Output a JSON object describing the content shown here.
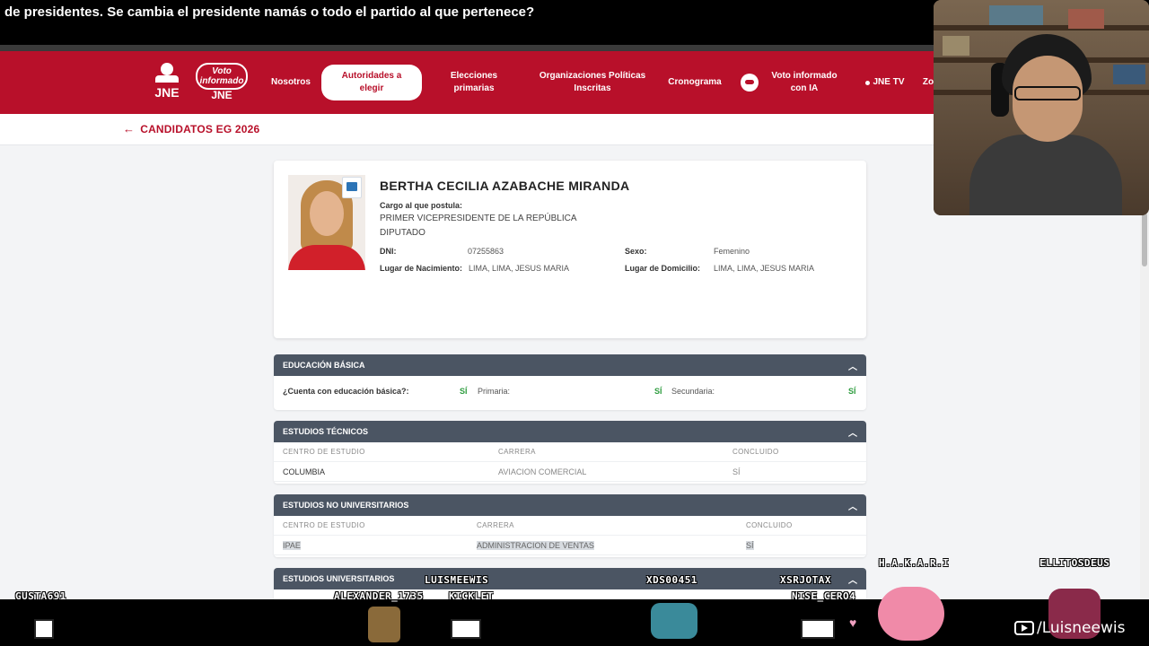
{
  "caption": "de presidentes. Se cambia el presidente namás o todo el partido al que pertenece?",
  "navbar": {
    "logo_jne": "JNE",
    "logo_vi_top": "Voto informado",
    "logo_vi_bottom": "JNE",
    "items": [
      "Nosotros",
      "Autoridades a elegir",
      "Elecciones primarias",
      "Organizaciones Políticas Inscritas",
      "Cronograma",
      "Voto informado con IA",
      "JNE TV",
      "Zo"
    ],
    "active": "Autoridades a elegir"
  },
  "back_link": "CANDIDATOS EG 2026",
  "candidate": {
    "name": "BERTHA CECILIA AZABACHE MIRANDA",
    "cargo_label": "Cargo al que postula:",
    "positions": [
      "PRIMER VICEPRESIDENTE DE LA REPÚBLICA",
      "DIPUTADO"
    ],
    "dni_label": "DNI:",
    "dni": "07255863",
    "sexo_label": "Sexo:",
    "sexo": "Femenino",
    "nacimiento_label": "Lugar de Nacimiento:",
    "nacimiento": "LIMA, LIMA, JESUS MARIA",
    "domicilio_label": "Lugar de Domicilio:",
    "domicilio": "LIMA, LIMA, JESUS MARIA"
  },
  "educacion_basica": {
    "title": "EDUCACIÓN BÁSICA",
    "q1": "¿Cuenta con educación básica?:",
    "a1": "SÍ",
    "q2": "Primaria:",
    "a2": "SÍ",
    "q3": "Secundaria:",
    "a3": "SÍ"
  },
  "estudios_tecnicos": {
    "title": "ESTUDIOS TÉCNICOS",
    "headers": [
      "CENTRO DE ESTUDIO",
      "CARRERA",
      "CONCLUIDO"
    ],
    "row": [
      "COLUMBIA",
      "AVIACION COMERCIAL",
      "SÍ"
    ]
  },
  "estudios_no_universitarios": {
    "title": "ESTUDIOS NO UNIVERSITARIOS",
    "headers": [
      "CENTRO DE ESTUDIO",
      "CARRERA",
      "CONCLUIDO"
    ],
    "row": [
      "IPAE",
      "ADMINISTRACION DE VENTAS",
      "SÍ"
    ]
  },
  "estudios_universitarios": {
    "title": "ESTUDIOS UNIVERSITARIOS"
  },
  "chat_names": {
    "luismeewis": "LUISMEEWIS",
    "xds": "XDS00451",
    "xsrjotax": "XSRJOTAX",
    "hakari": "H.A.K.A.R.I",
    "ellitos": "ELLITOSDEUS",
    "gusta": "GUSTA691",
    "alexander": "ALEXANDER_1735",
    "kicklet": "KICKLET",
    "nise": "NISE_CERO4"
  },
  "brand": "/Luisneewis",
  "colors": {
    "nav_red": "#b8102a",
    "section_header": "#4b5563",
    "yes_green": "#2e9d3f"
  }
}
